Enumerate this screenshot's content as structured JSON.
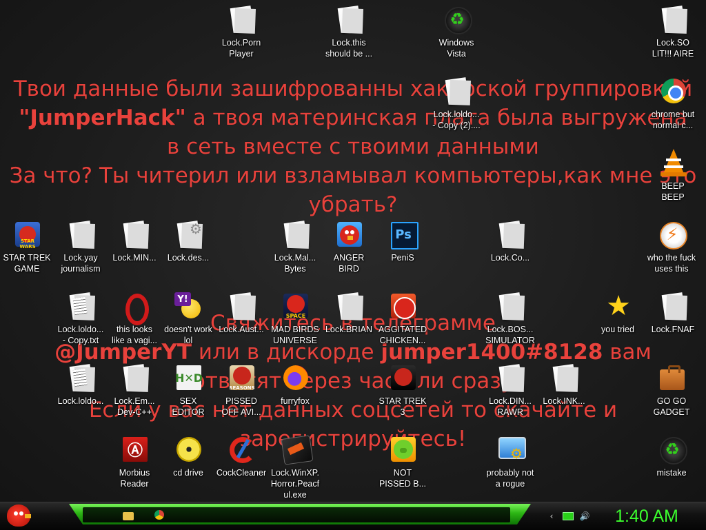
{
  "message": {
    "line1": "Твои данные были зашифрованны хакерской группировкой",
    "line2_bold": "\"JumperHack\"",
    "line2_rest": " а твоя материнская плата была выгружена",
    "line3": "в сеть вместе с твоими данными",
    "line4": "За что? Ты читерил или взламывал компьютеры,как мне это",
    "line5": "убрать?",
    "line6": "Свяжитесь в телеграмме",
    "line7_bold1": "@JumperYT",
    "line7_mid": " или в дискорде ",
    "line7_bold2": "jumper1400#8128",
    "line7_end": " вам",
    "line8": "ответят через час или сразу",
    "line9": "Если у вас нет данных соцсетей то скачайте и",
    "line10": "зарегистрируйтесь!",
    "color": "#e8423c"
  },
  "icons": [
    {
      "label": "Lock.Porn\nPlayer",
      "icon": "document-icon"
    },
    {
      "label": "Lock.this\nshould be ...",
      "icon": "document-icon"
    },
    {
      "label": "Windows\nVista",
      "icon": "green-recycle-icon"
    },
    {
      "label": "Lock.SO\nLIT!!! AIRE",
      "icon": "document-icon"
    },
    {
      "label": "Lock.loldo...\n- Copy (2)....",
      "icon": "document-icon"
    },
    {
      "label": "chrome but\nnormal c...",
      "icon": "chrome-icon"
    },
    {
      "label": "BEEP\nBEEP",
      "icon": "vlc-cone-icon"
    },
    {
      "label": "STAR TREK\nGAME",
      "icon": "angry-birds-star-wars-icon"
    },
    {
      "label": "Lock.yay\njournalism",
      "icon": "document-icon"
    },
    {
      "label": "Lock.MIN...",
      "icon": "document-icon"
    },
    {
      "label": "Lock.des...",
      "icon": "document-gear-icon"
    },
    {
      "label": "Lock.Mal...\nBytes",
      "icon": "document-icon"
    },
    {
      "label": "ANGER\nBIRD",
      "icon": "angry-birds-icon"
    },
    {
      "label": "PeniS",
      "icon": "photoshop-icon"
    },
    {
      "label": "Lock.Co...",
      "icon": "document-icon"
    },
    {
      "label": "who the fuck\nuses this",
      "icon": "winamp-bolt-icon"
    },
    {
      "label": "Lock.loldo...\n- Copy.txt",
      "icon": "text-document-icon"
    },
    {
      "label": "this looks\nlike a vagi...",
      "icon": "opera-icon"
    },
    {
      "label": "doesn't work\nlol",
      "icon": "yahoo-messenger-icon"
    },
    {
      "label": "Lock.Aust...",
      "icon": "document-icon"
    },
    {
      "label": "MAD BIRDS\nUNIVERSE",
      "icon": "angry-birds-space-icon"
    },
    {
      "label": "Lock.BRIAN",
      "icon": "document-icon"
    },
    {
      "label": "AGGITATED\nCHICKEN...",
      "icon": "angry-birds-rio-icon"
    },
    {
      "label": "Lock.BOS...\nSIMULATOR",
      "icon": "document-icon"
    },
    {
      "label": "you tried",
      "icon": "star-icon"
    },
    {
      "label": "Lock.FNAF",
      "icon": "document-icon"
    },
    {
      "label": "Lock.loldo...",
      "icon": "text-document-icon"
    },
    {
      "label": "Lock.Em...\nDev-C++",
      "icon": "document-icon"
    },
    {
      "label": "SEX\nEDITOR",
      "icon": "hxd-icon"
    },
    {
      "label": "PISSED\nOFF AVI...",
      "icon": "angry-birds-seasons-icon"
    },
    {
      "label": "furryfox",
      "icon": "firefox-icon"
    },
    {
      "label": "STAR TREK\n3",
      "icon": "angry-birds-star-wars-2-icon"
    },
    {
      "label": "Lock.DIN...\nRAWR",
      "icon": "document-icon"
    },
    {
      "label": "Lock.INK...",
      "icon": "document-icon"
    },
    {
      "label": "GO GO\nGADGET",
      "icon": "briefcase-icon"
    },
    {
      "label": "Morbius\nReader",
      "icon": "acrobat-reader-icon"
    },
    {
      "label": "cd drive",
      "icon": "cd-icon"
    },
    {
      "label": "CockCleaner",
      "icon": "ccleaner-icon"
    },
    {
      "label": "Lock.WinXP.\nHorror.Peacf\nul.exe",
      "icon": "document-icon"
    },
    {
      "label": "NOT\nPISSED B...",
      "icon": "bad-piggies-icon"
    },
    {
      "label": "probably not\na rogue",
      "icon": "settings-monitor-icon"
    },
    {
      "label": "mistake",
      "icon": "green-recycle-icon"
    }
  ],
  "taskbar": {
    "clock": "1:40 AM",
    "start_icon": "angry-bird-start-orb-icon",
    "pinned": [
      "folder-icon",
      "chrome-icon"
    ],
    "tray": [
      "network-arrow-icon",
      "monitor-icon",
      "speaker-icon"
    ],
    "accent": "#3cff2e"
  }
}
